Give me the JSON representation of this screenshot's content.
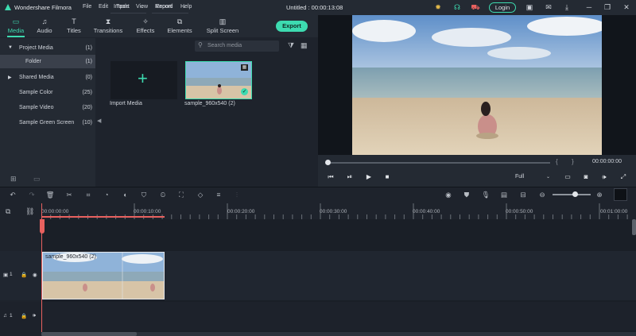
{
  "titlebar": {
    "app_name": "Wondershare Filmora",
    "menus": [
      "File",
      "Edit",
      "Tools",
      "View",
      "Export",
      "Help"
    ],
    "project_title": "Untitled : 00:00:13:08",
    "login_label": "Login"
  },
  "tabs": [
    {
      "label": "Media",
      "icon": "folder-icon"
    },
    {
      "label": "Audio",
      "icon": "music-note-icon"
    },
    {
      "label": "Titles",
      "icon": "text-icon"
    },
    {
      "label": "Transitions",
      "icon": "transition-icon"
    },
    {
      "label": "Effects",
      "icon": "sparkle-icon"
    },
    {
      "label": "Elements",
      "icon": "elements-icon"
    },
    {
      "label": "Split Screen",
      "icon": "split-screen-icon"
    }
  ],
  "export_label": "Export",
  "library": [
    {
      "name": "Project Media",
      "count": "(1)"
    },
    {
      "name": "Folder",
      "count": "(1)"
    },
    {
      "name": "Shared Media",
      "count": "(0)"
    },
    {
      "name": "Sample Color",
      "count": "(25)"
    },
    {
      "name": "Sample Video",
      "count": "(20)"
    },
    {
      "name": "Sample Green Screen",
      "count": "(10)"
    }
  ],
  "media_toolbar": {
    "import_label": "Import",
    "record_label": "Record",
    "search_placeholder": "Search media"
  },
  "media_items": {
    "import_caption": "Import Media",
    "clip_caption": "sample_960x540 (2)"
  },
  "preview": {
    "timecode": "00:00:00:00",
    "quality": "Full"
  },
  "timeline": {
    "ruler_labels": [
      "00:00:00:00",
      "00:00:10:00",
      "00:00:20:00",
      "00:00:30:00",
      "00:00:40:00",
      "00:00:50:00",
      "00:01:00:00"
    ],
    "clip_title": "sample_960x540 (2)",
    "video_track_label": "1",
    "audio_track_label": "1"
  },
  "colors": {
    "accent": "#3ddbb0",
    "playhead": "#e8615f",
    "background": "#1e232c"
  }
}
